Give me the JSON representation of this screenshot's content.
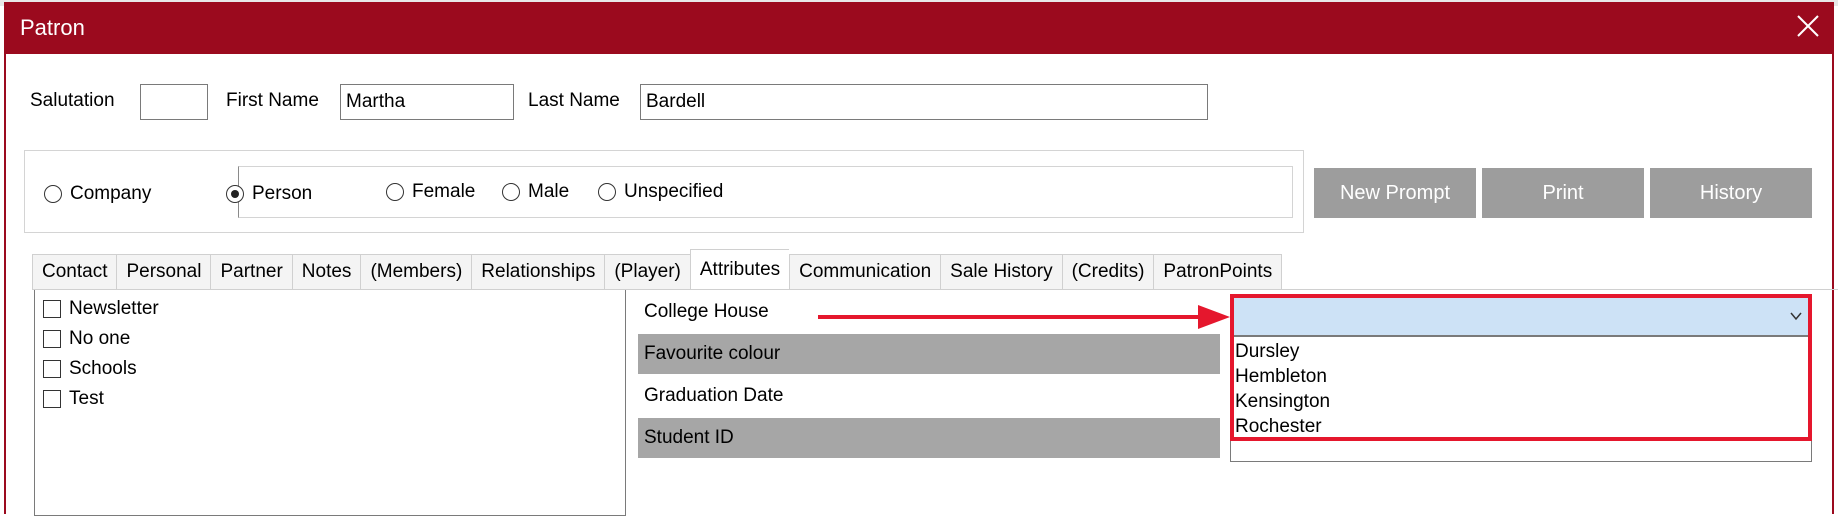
{
  "window": {
    "title": "Patron"
  },
  "name_row": {
    "salutation_label": "Salutation",
    "salutation_value": "",
    "first_name_label": "First Name",
    "first_name_value": "Martha",
    "last_name_label": "Last Name",
    "last_name_value": "Bardell"
  },
  "type_radios": [
    {
      "label": "Company",
      "checked": false
    },
    {
      "label": "Person",
      "checked": true
    }
  ],
  "gender_radios": [
    {
      "label": "Female",
      "checked": false
    },
    {
      "label": "Male",
      "checked": false
    },
    {
      "label": "Unspecified",
      "checked": false
    }
  ],
  "action_buttons": [
    "New Prompt",
    "Print",
    "History"
  ],
  "tabs": [
    "Contact",
    "Personal",
    "Partner",
    "Notes",
    "(Members)",
    "Relationships",
    "(Player)",
    "Attributes",
    "Communication",
    "Sale History",
    "(Credits)",
    "PatronPoints"
  ],
  "active_tab": "Attributes",
  "checkbox_list": [
    "Newsletter",
    "No one",
    "Schools",
    "Test"
  ],
  "attributes": [
    "College House",
    "Favourite colour",
    "Graduation Date",
    "Student ID"
  ],
  "college_house_combo": {
    "value": "",
    "options": [
      "Dursley",
      "Hembleton",
      "Kensington",
      "Rochester"
    ]
  },
  "colors": {
    "titlebar": "#9b0a1e",
    "button_grey": "#9d9d9d",
    "highlight_red": "#e5172d",
    "combo_selected": "#cde2f6",
    "label_grey": "#a6a6a6"
  },
  "icons": [
    "close-icon",
    "chevron-down-icon",
    "arrow-annotation"
  ]
}
